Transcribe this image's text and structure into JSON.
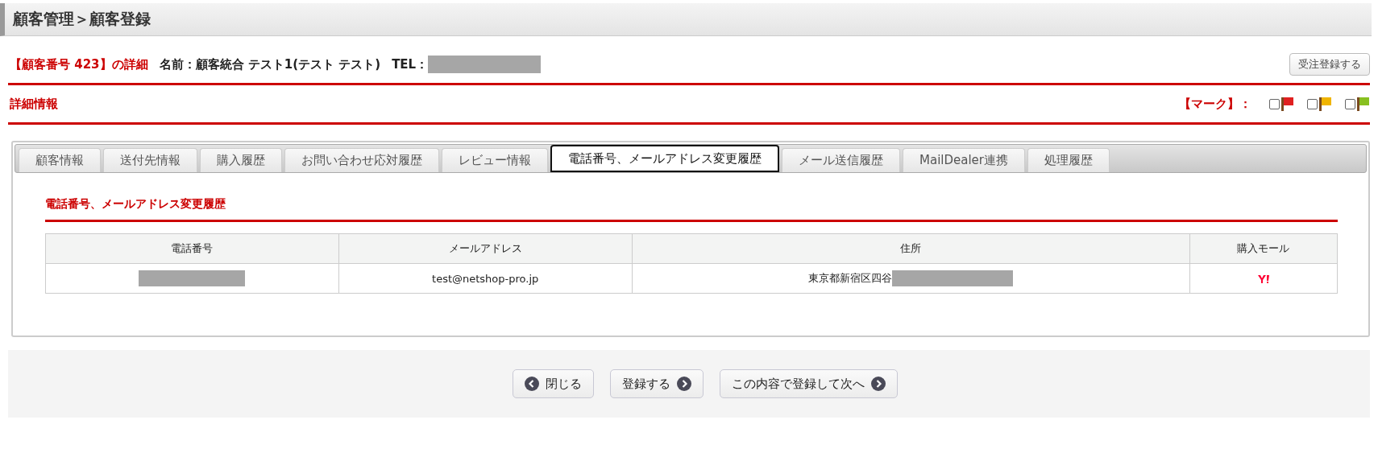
{
  "breadcrumb": "顧客管理＞顧客登録",
  "detail": {
    "heading": "【顧客番号 423】の詳細",
    "name": "名前：顧客統合 テスト1(テスト テスト)",
    "tel_label": "TEL：",
    "tel_redacted": true
  },
  "order_button": "受注登録する",
  "section_title": "詳細情報",
  "mark_label": "【マーク】：",
  "marks": [
    {
      "checked": false,
      "color": "#e02020"
    },
    {
      "checked": false,
      "color": "#f0b400"
    },
    {
      "checked": false,
      "color": "#88c020"
    }
  ],
  "tabs": [
    {
      "label": "顧客情報",
      "selected": false
    },
    {
      "label": "送付先情報",
      "selected": false
    },
    {
      "label": "購入履歴",
      "selected": false
    },
    {
      "label": "お問い合わせ応対履歴",
      "selected": false
    },
    {
      "label": "レビュー情報",
      "selected": false
    },
    {
      "label": "電話番号、メールアドレス変更履歴",
      "selected": true
    },
    {
      "label": "メール送信履歴",
      "selected": false
    },
    {
      "label": "MailDealer連携",
      "selected": false
    },
    {
      "label": "処理履歴",
      "selected": false
    }
  ],
  "panel_title": "電話番号、メールアドレス変更履歴",
  "table": {
    "columns": [
      "電話番号",
      "メールアドレス",
      "住所",
      "購入モール"
    ],
    "rows": [
      {
        "phone_redacted": true,
        "email": "test@netshop-pro.jp",
        "address": "東京都新宿区四谷",
        "address_redacted": true,
        "mall_logo": true
      }
    ]
  },
  "buttons": [
    {
      "label": "閉じる",
      "kind": "back"
    },
    {
      "label": "登録する",
      "kind": "next"
    },
    {
      "label": "この内容で登録して次へ",
      "kind": "next"
    }
  ]
}
